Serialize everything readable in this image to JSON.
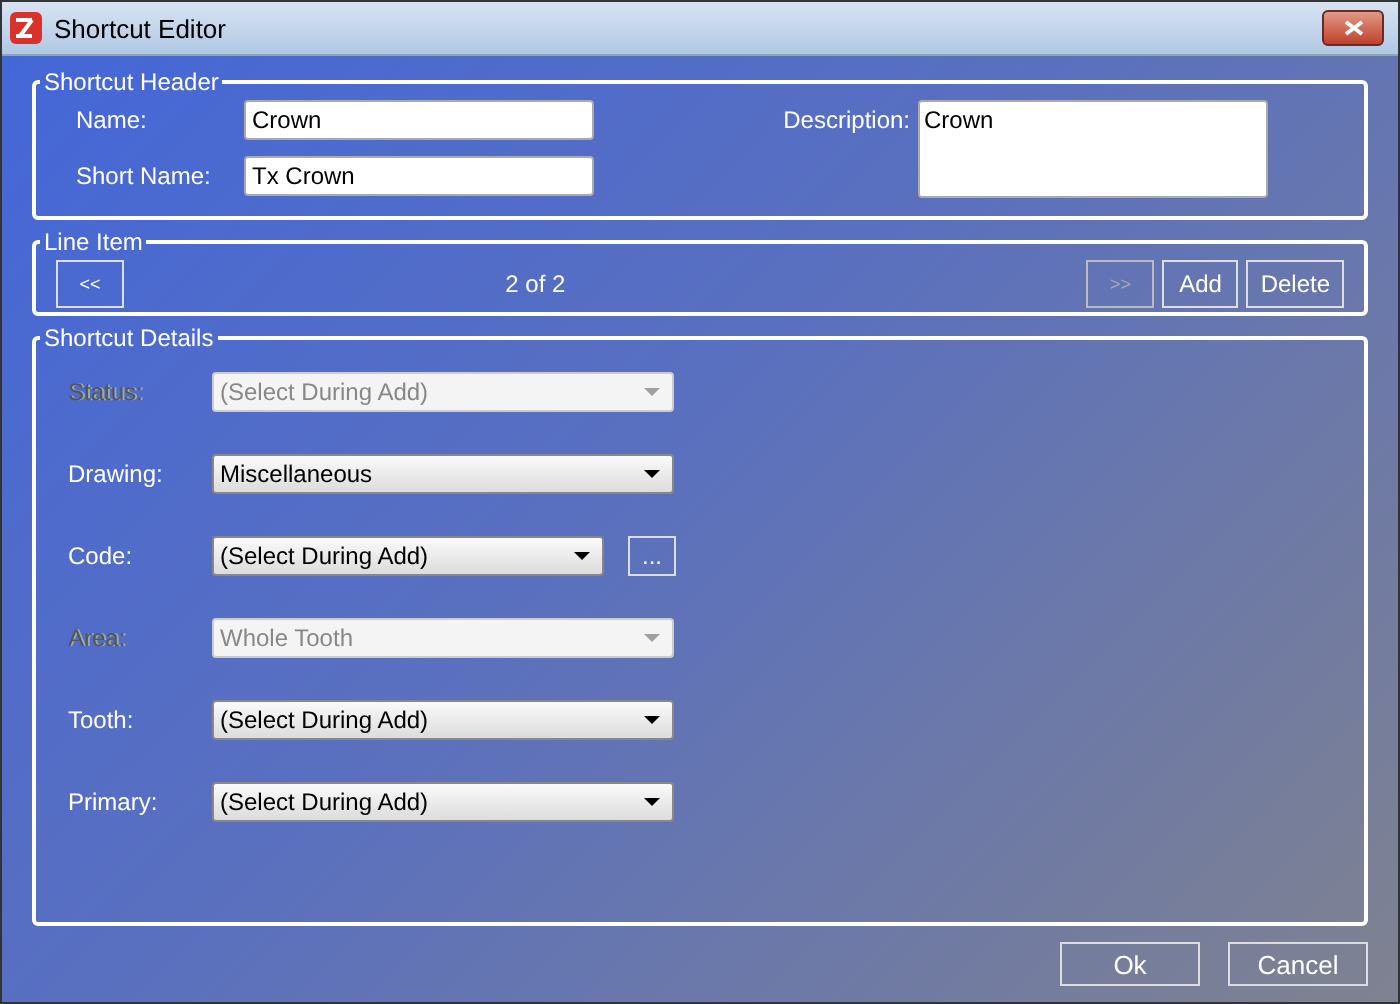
{
  "window": {
    "title": "Shortcut Editor"
  },
  "shortcut_header": {
    "title": "Shortcut Header",
    "name": {
      "label": "Name:",
      "value": "Crown"
    },
    "short_name": {
      "label": "Short Name:",
      "value": "Tx Crown"
    },
    "description": {
      "label": "Description:",
      "value": "Crown"
    }
  },
  "line_item": {
    "title": "Line Item",
    "prev": {
      "label": "<<",
      "disabled": false
    },
    "position": "2 of 2",
    "next": {
      "label": ">>",
      "disabled": true
    },
    "buttons": [
      "Add",
      "Delete"
    ]
  },
  "shortcut_details": {
    "title": "Shortcut Details",
    "fields": [
      {
        "label": "Status:",
        "value": "(Select During Add)",
        "disabled": true
      },
      {
        "label": "Drawing:",
        "value": "Miscellaneous",
        "disabled": false
      },
      {
        "label": "Code:",
        "value": "(Select During Add)",
        "disabled": false,
        "browse": "..."
      },
      {
        "label": "Area:",
        "value": "Whole Tooth",
        "disabled": true
      },
      {
        "label": "Tooth:",
        "value": "(Select During Add)",
        "disabled": false
      },
      {
        "label": "Primary:",
        "value": "(Select During Add)",
        "disabled": false
      }
    ]
  },
  "buttons": [
    "Ok",
    "Cancel"
  ]
}
